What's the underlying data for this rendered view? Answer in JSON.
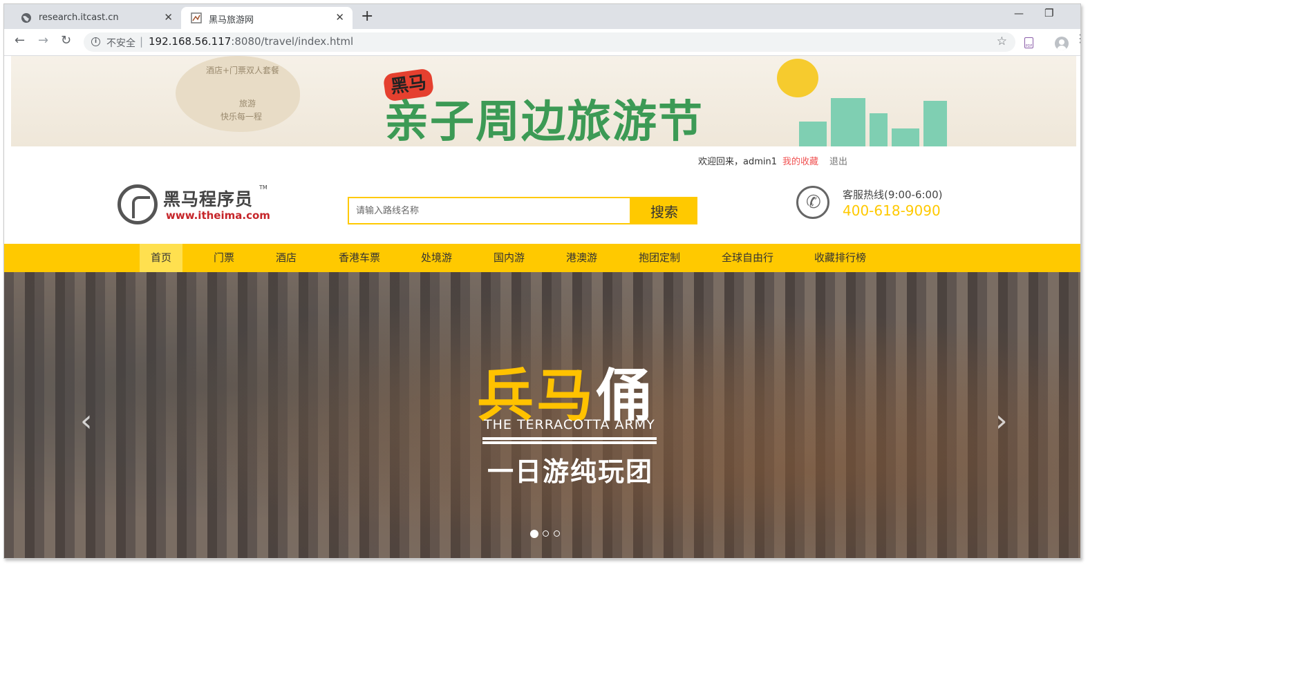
{
  "browser": {
    "tabs": [
      {
        "title": "research.itcast.cn",
        "active": false
      },
      {
        "title": "黑马旅游网",
        "active": true
      }
    ],
    "security_label": "不安全",
    "url_host": "192.168.56.117",
    "url_rest": ":8080/travel/index.html"
  },
  "banner": {
    "side_lines": [
      "酒店+门票双人套餐",
      "旅游",
      "快乐每一程"
    ],
    "badge": "黑马",
    "title": "亲子周边旅游节"
  },
  "topbar": {
    "welcome": "欢迎回来，admin1",
    "favorites": "我的收藏",
    "logout": "退出"
  },
  "logo": {
    "name_cn": "黑马程序员",
    "tm": "TM",
    "url": "www.itheima.com"
  },
  "search": {
    "placeholder": "请输入路线名称",
    "button": "搜索"
  },
  "hotline": {
    "label": "客服热线(9:00-6:00)",
    "number": "400-618-9090"
  },
  "nav": {
    "items": [
      "首页",
      "门票",
      "酒店",
      "香港车票",
      "处境游",
      "国内游",
      "港澳游",
      "抱团定制",
      "全球自由行",
      "收藏排行榜"
    ],
    "active_index": 0
  },
  "hero": {
    "title_yellow": "兵马",
    "title_white": "俑",
    "subtitle_en": "THE TERRACOTTA ARMY",
    "subtitle_cn": "一日游纯玩团",
    "slide_count": 3,
    "active_slide": 0
  },
  "colors": {
    "accent": "#ffc900",
    "link_red": "#f05252",
    "logo_red": "#c6262a"
  }
}
